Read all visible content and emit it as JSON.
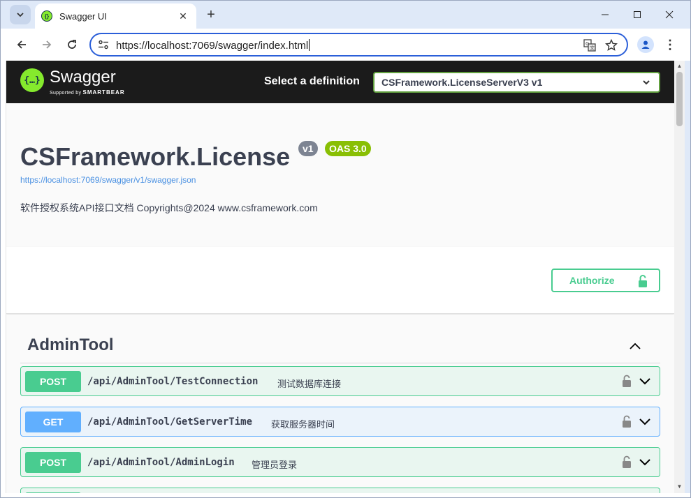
{
  "browser": {
    "tab_title": "Swagger UI",
    "url": "https://localhost:7069/swagger/index.html",
    "new_tab_symbol": "+",
    "tab_close_symbol": "✕"
  },
  "swagger": {
    "logo_text": "Swagger",
    "logo_mark": "{…}",
    "supported_by": "Supported by",
    "smartbear": "SMARTBEAR",
    "select_label": "Select a definition",
    "definition": "CSFramework.LicenseServerV3 v1",
    "title": "CSFramework.License",
    "version": "v1",
    "oas": "OAS 3.0",
    "spec_url": "https://localhost:7069/swagger/v1/swagger.json",
    "description": "软件授权系统API接口文档 Copyrights@2024 www.csframework.com",
    "authorize_label": "Authorize",
    "accent": "#49cc90",
    "get_color": "#61affe"
  },
  "section": {
    "title": "AdminTool",
    "operations": [
      {
        "method": "POST",
        "path": "/api/AdminTool/TestConnection",
        "summary": "测试数据库连接"
      },
      {
        "method": "GET",
        "path": "/api/AdminTool/GetServerTime",
        "summary": "获取服务器时间"
      },
      {
        "method": "POST",
        "path": "/api/AdminTool/AdminLogin",
        "summary": "管理员登录"
      }
    ]
  }
}
